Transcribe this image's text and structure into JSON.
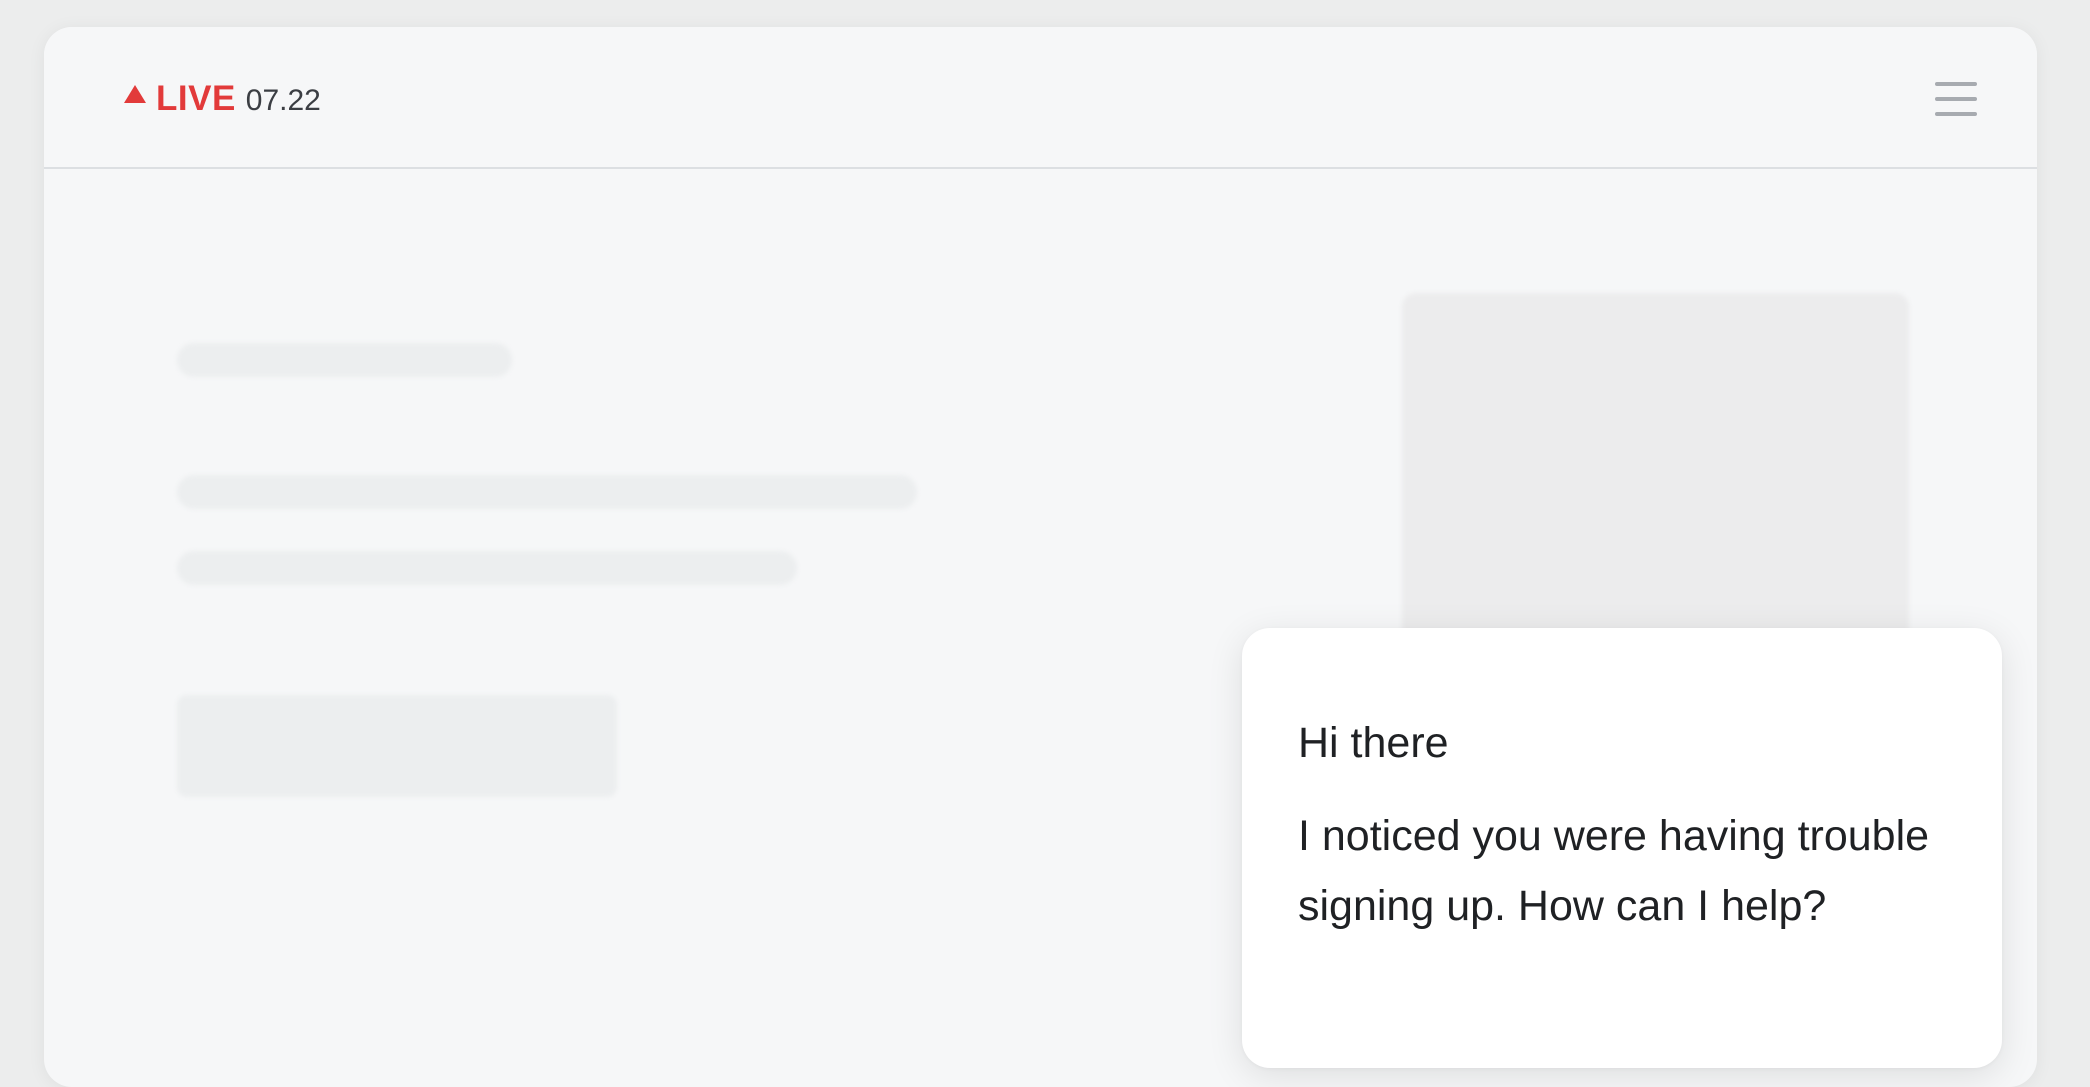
{
  "header": {
    "live_label": "LIVE",
    "live_time": "07.22",
    "live_icon": "triangle-up-icon",
    "menu_icon": "hamburger-menu-icon",
    "accent_color": "#e23a3a"
  },
  "chat": {
    "greeting": "Hi there",
    "message": "I noticed you were having trouble signing up. How can I help?"
  }
}
